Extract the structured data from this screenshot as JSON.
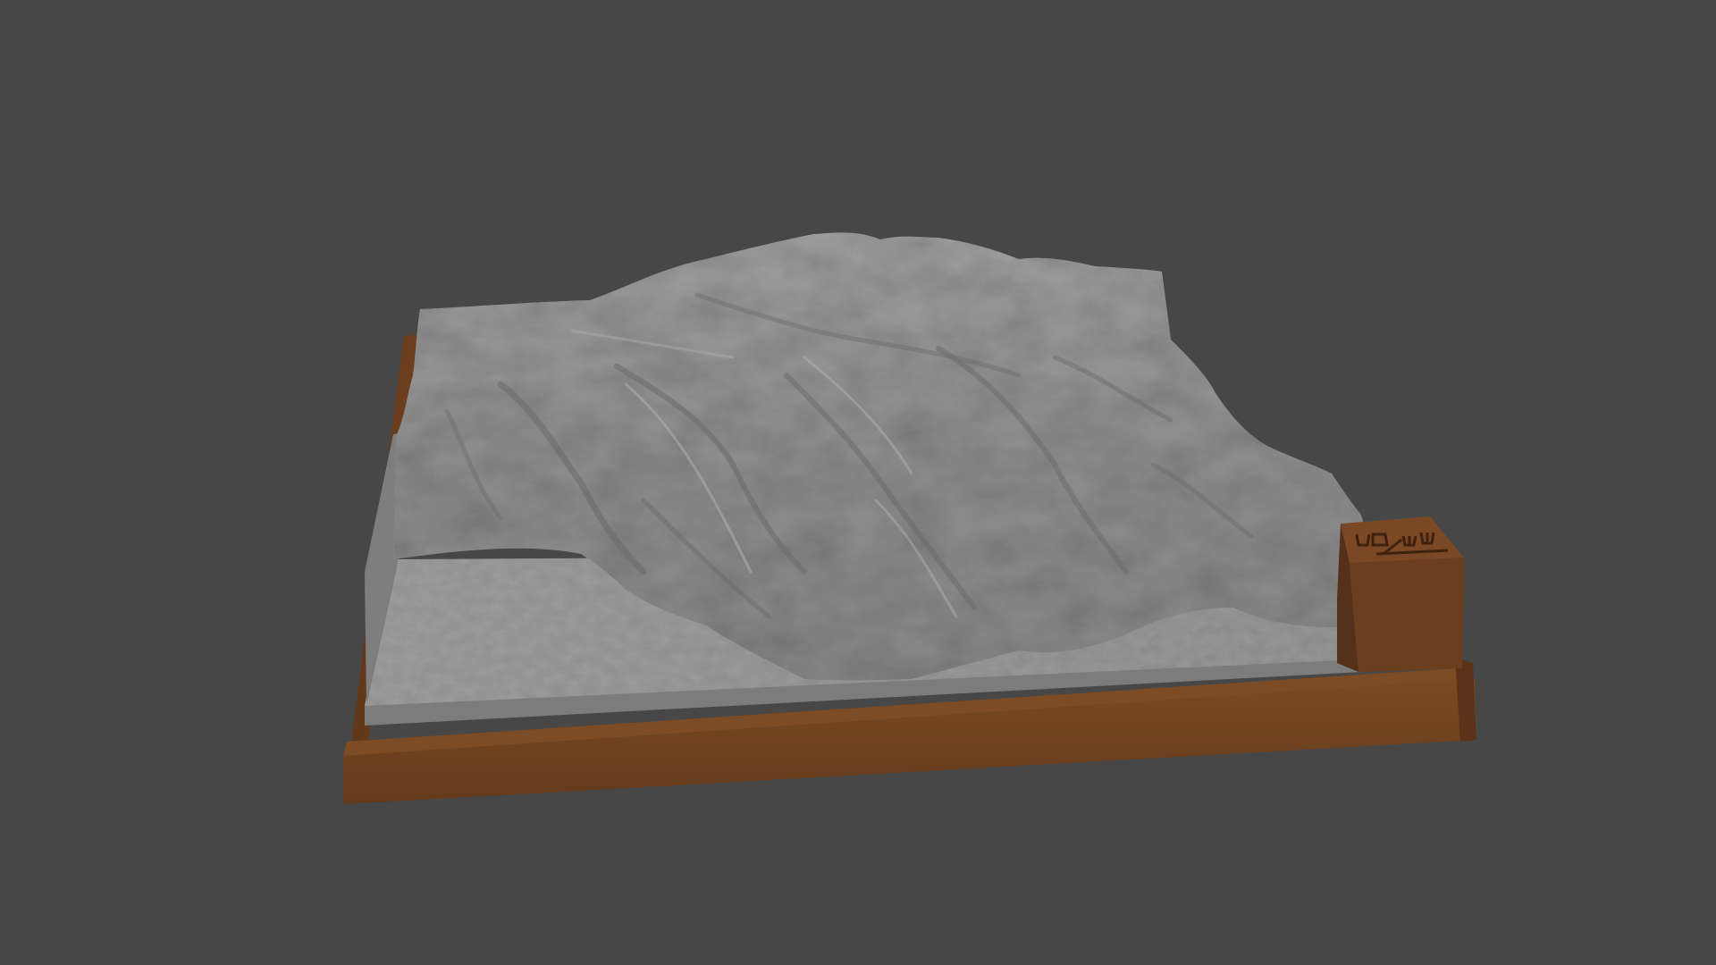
{
  "viewport": {
    "background_color": "#474747"
  },
  "model": {
    "terrain_color": "#8f8f8f",
    "terrain_shadow_color": "#5a5a5a",
    "terrain_highlight_color": "#b0b0b0",
    "flat_surface_color": "#8a8a8a",
    "base_color": "#6b3e1f",
    "base_dark_color": "#55301a",
    "label_box_engraving_glyphs": "Ш☐/Ш"
  }
}
